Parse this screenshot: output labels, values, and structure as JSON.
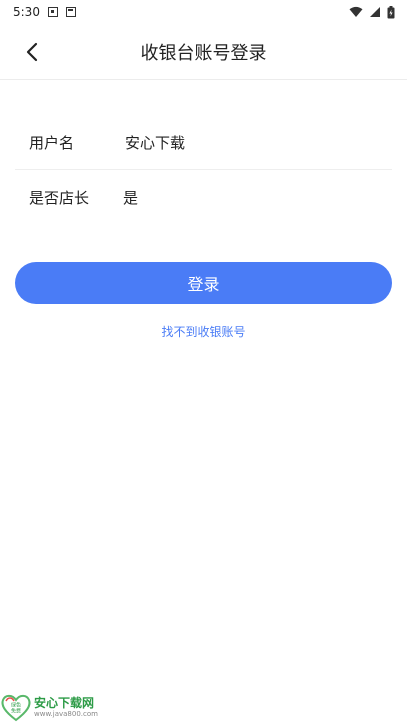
{
  "status_bar": {
    "time": "5:30"
  },
  "header": {
    "title": "收银台账号登录"
  },
  "form": {
    "username": {
      "label": "用户名",
      "value": "安心下载"
    },
    "is_store_manager": {
      "label": "是否店长",
      "value": "是"
    }
  },
  "login_button": {
    "label": "登录"
  },
  "help_link": {
    "label": "找不到收银账号"
  },
  "watermark": {
    "name": "安心下载网",
    "url": "www.java800.com",
    "badge_line1": "绿色",
    "badge_line2": "免费"
  },
  "colors": {
    "accent": "#4a7cf6",
    "watermark_green": "#2c9b46"
  }
}
